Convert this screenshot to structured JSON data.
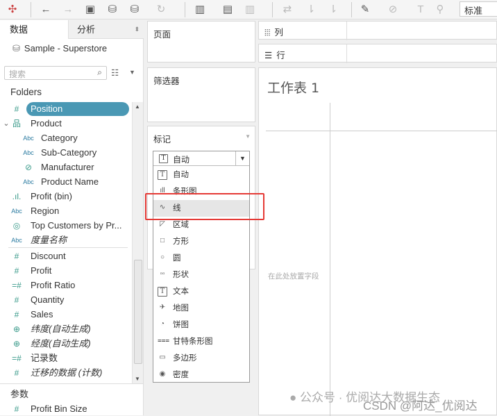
{
  "toolbar": {
    "icons": [
      "tableau-logo-icon",
      "back-icon",
      "forward-icon",
      "save-icon",
      "new-datasource-icon",
      "pause-updates-icon",
      "refresh-icon",
      "new-worksheet-icon",
      "duplicate-sheet-icon",
      "clear-sheet-icon",
      "swap-icon",
      "sort-asc-icon",
      "sort-desc-icon",
      "highlight-icon",
      "annotate-icon",
      "label-icon",
      "pin-icon"
    ],
    "view_select": "标准"
  },
  "left": {
    "tabs": [
      "数据",
      "分析"
    ],
    "datasource": "Sample - Superstore",
    "search_placeholder": "搜索",
    "folders_label": "Folders",
    "dimensions": [
      {
        "label": "Position",
        "icon": "#",
        "selected": true
      },
      {
        "label": "Product",
        "icon": "hierarchy"
      },
      {
        "label": "Category",
        "icon": "Abc",
        "indent": true
      },
      {
        "label": "Sub-Category",
        "icon": "Abc",
        "indent": true
      },
      {
        "label": "Manufacturer",
        "icon": "paperclip",
        "indent": true
      },
      {
        "label": "Product Name",
        "icon": "Abc",
        "indent": true
      },
      {
        "label": "Profit (bin)",
        "icon": "bin"
      },
      {
        "label": "Region",
        "icon": "Abc"
      },
      {
        "label": "Top Customers by Pr...",
        "icon": "set"
      },
      {
        "label": "度量名称",
        "icon": "Abc",
        "italic": true
      }
    ],
    "measures": [
      {
        "label": "Discount",
        "icon": "#"
      },
      {
        "label": "Profit",
        "icon": "#"
      },
      {
        "label": "Profit Ratio",
        "icon": "=#"
      },
      {
        "label": "Quantity",
        "icon": "#"
      },
      {
        "label": "Sales",
        "icon": "#"
      },
      {
        "label": "纬度(自动生成)",
        "icon": "globe",
        "italic": true
      },
      {
        "label": "经度(自动生成)",
        "icon": "globe",
        "italic": true
      },
      {
        "label": "记录数",
        "icon": "=#"
      },
      {
        "label": "迁移的数据 (计数)",
        "icon": "#",
        "italic": true
      }
    ],
    "params_label": "参数",
    "params": [
      {
        "label": "Profit Bin Size",
        "icon": "#"
      }
    ]
  },
  "cards": {
    "pages": "页面",
    "filters": "筛选器",
    "marks": "标记"
  },
  "shelves": {
    "columns": "列",
    "rows": "行"
  },
  "marks_dropdown": {
    "selected": "自动",
    "highlighted": "线",
    "options": [
      {
        "label": "自动",
        "icon": "T"
      },
      {
        "label": "条形图",
        "icon": "bar"
      },
      {
        "label": "线",
        "icon": "line"
      },
      {
        "label": "区域",
        "icon": "area"
      },
      {
        "label": "方形",
        "icon": "square"
      },
      {
        "label": "圆",
        "icon": "circle"
      },
      {
        "label": "形状",
        "icon": "shapes"
      },
      {
        "label": "文本",
        "icon": "T"
      },
      {
        "label": "地图",
        "icon": "map"
      },
      {
        "label": "饼图",
        "icon": "pie"
      },
      {
        "label": "甘特条形图",
        "icon": "gantt"
      },
      {
        "label": "多边形",
        "icon": "polygon"
      },
      {
        "label": "密度",
        "icon": "density"
      }
    ]
  },
  "sheet": {
    "title": "工作表 1",
    "drop_hint": "在此处放置字段"
  },
  "watermark": {
    "line1": "公众号 · 优阅达大数据生态",
    "line2": "CSDN @阿达_优阅达"
  },
  "colors": {
    "selected_pill": "#4a98b4",
    "field_icon": "#3a9a8a",
    "highlight_box": "#e53935"
  }
}
